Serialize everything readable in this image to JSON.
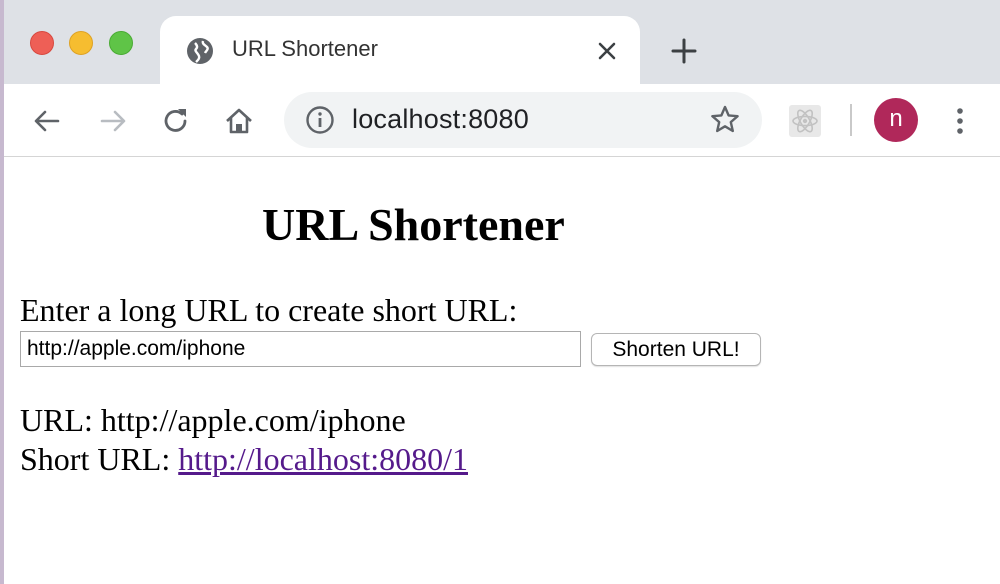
{
  "browser": {
    "tab": {
      "title": "URL Shortener",
      "favicon": "globe-icon"
    },
    "address_bar": {
      "url": "localhost:8080",
      "info_icon": "info-icon",
      "bookmark_icon": "star-icon"
    },
    "profile": {
      "initial": "n",
      "color": "#b0285a"
    },
    "traffic_light_colors": {
      "close": "#ee5f56",
      "minimize": "#f6bd30",
      "maximize": "#5fc447"
    }
  },
  "page": {
    "title": "URL Shortener",
    "form": {
      "prompt": "Enter a long URL to create short URL:",
      "input_value": "http://apple.com/iphone",
      "submit_label": "Shorten URL!"
    },
    "result": {
      "url_label": "URL: ",
      "url_value": "http://apple.com/iphone",
      "short_label": "Short URL: ",
      "short_value": "http://localhost:8080/1",
      "link_color": "#551a8b"
    }
  }
}
